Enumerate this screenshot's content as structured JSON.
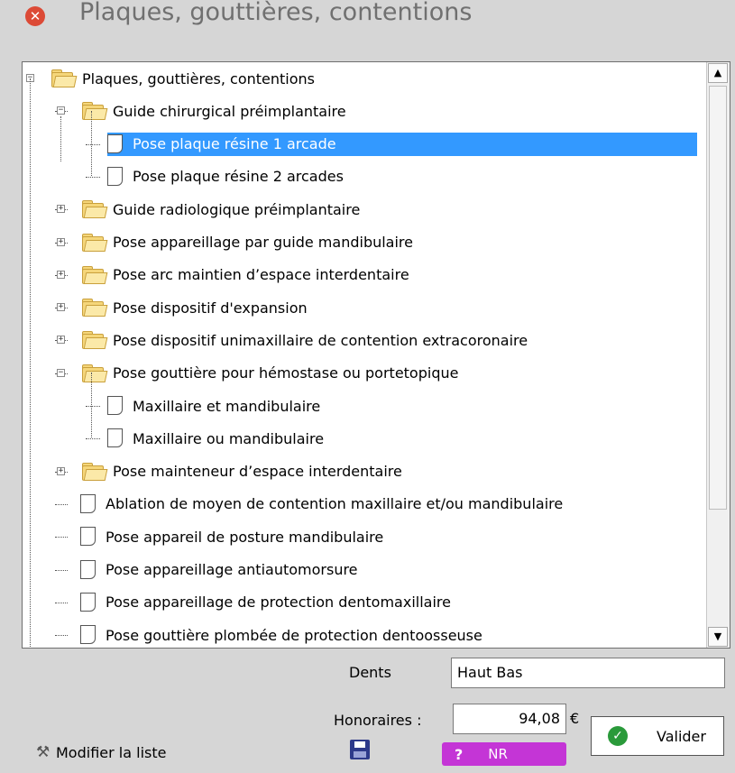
{
  "window": {
    "title": "Plaques, gouttières, contentions",
    "close_icon": "close-icon"
  },
  "tree": [
    {
      "label": "Plaques, gouttières, contentions",
      "type": "folder",
      "level": 0,
      "expanded": true
    },
    {
      "label": "Guide chirurgical préimplantaire",
      "type": "folder",
      "level": 1,
      "expanded": true
    },
    {
      "label": "Pose plaque résine 1 arcade",
      "type": "doc",
      "level": 2,
      "selected": true
    },
    {
      "label": "Pose plaque résine 2 arcades",
      "type": "doc",
      "level": 2
    },
    {
      "label": "Guide radiologique préimplantaire",
      "type": "folder",
      "level": 1,
      "expanded": false
    },
    {
      "label": "Pose appareillage par guide mandibulaire",
      "type": "folder",
      "level": 1,
      "expanded": false
    },
    {
      "label": "Pose arc maintien d’espace interdentaire",
      "type": "folder",
      "level": 1,
      "expanded": false
    },
    {
      "label": "Pose dispositif d'expansion",
      "type": "folder",
      "level": 1,
      "expanded": false
    },
    {
      "label": "Pose dispositif unimaxillaire de contention extracoronaire",
      "type": "folder",
      "level": 1,
      "expanded": false
    },
    {
      "label": "Pose gouttière pour hémostase ou portetopique",
      "type": "folder",
      "level": 1,
      "expanded": true
    },
    {
      "label": "Maxillaire et mandibulaire",
      "type": "doc",
      "level": 2
    },
    {
      "label": "Maxillaire ou mandibulaire",
      "type": "doc",
      "level": 2
    },
    {
      "label": "Pose mainteneur d’espace interdentaire",
      "type": "folder",
      "level": 1,
      "expanded": false
    },
    {
      "label": "Ablation de moyen de contention maxillaire et/ou mandibulaire",
      "type": "doc",
      "level": 1
    },
    {
      "label": "Pose appareil de posture mandibulaire",
      "type": "doc",
      "level": 1
    },
    {
      "label": "Pose appareillage antiautomorsure",
      "type": "doc",
      "level": 1
    },
    {
      "label": "Pose appareillage de protection dentomaxillaire",
      "type": "doc",
      "level": 1
    },
    {
      "label": "Pose gouttière plombée de protection dentoosseuse",
      "type": "doc",
      "level": 1
    }
  ],
  "form": {
    "dents_label": "Dents",
    "dents_value": "Haut Bas",
    "honoraires_label": "Honoraires :",
    "honoraires_value": "94,08",
    "currency": "€"
  },
  "actions": {
    "valider_label": "Valider",
    "nr_q": "?",
    "nr_label": "NR",
    "modifier_label": "Modifier la liste",
    "save_icon": "save-icon",
    "tools_icon": "tools-icon"
  },
  "colors": {
    "selection": "#3399ff",
    "nr_badge": "#c435d6",
    "valider_check": "#2a9a3a",
    "close": "#dc4a36"
  }
}
